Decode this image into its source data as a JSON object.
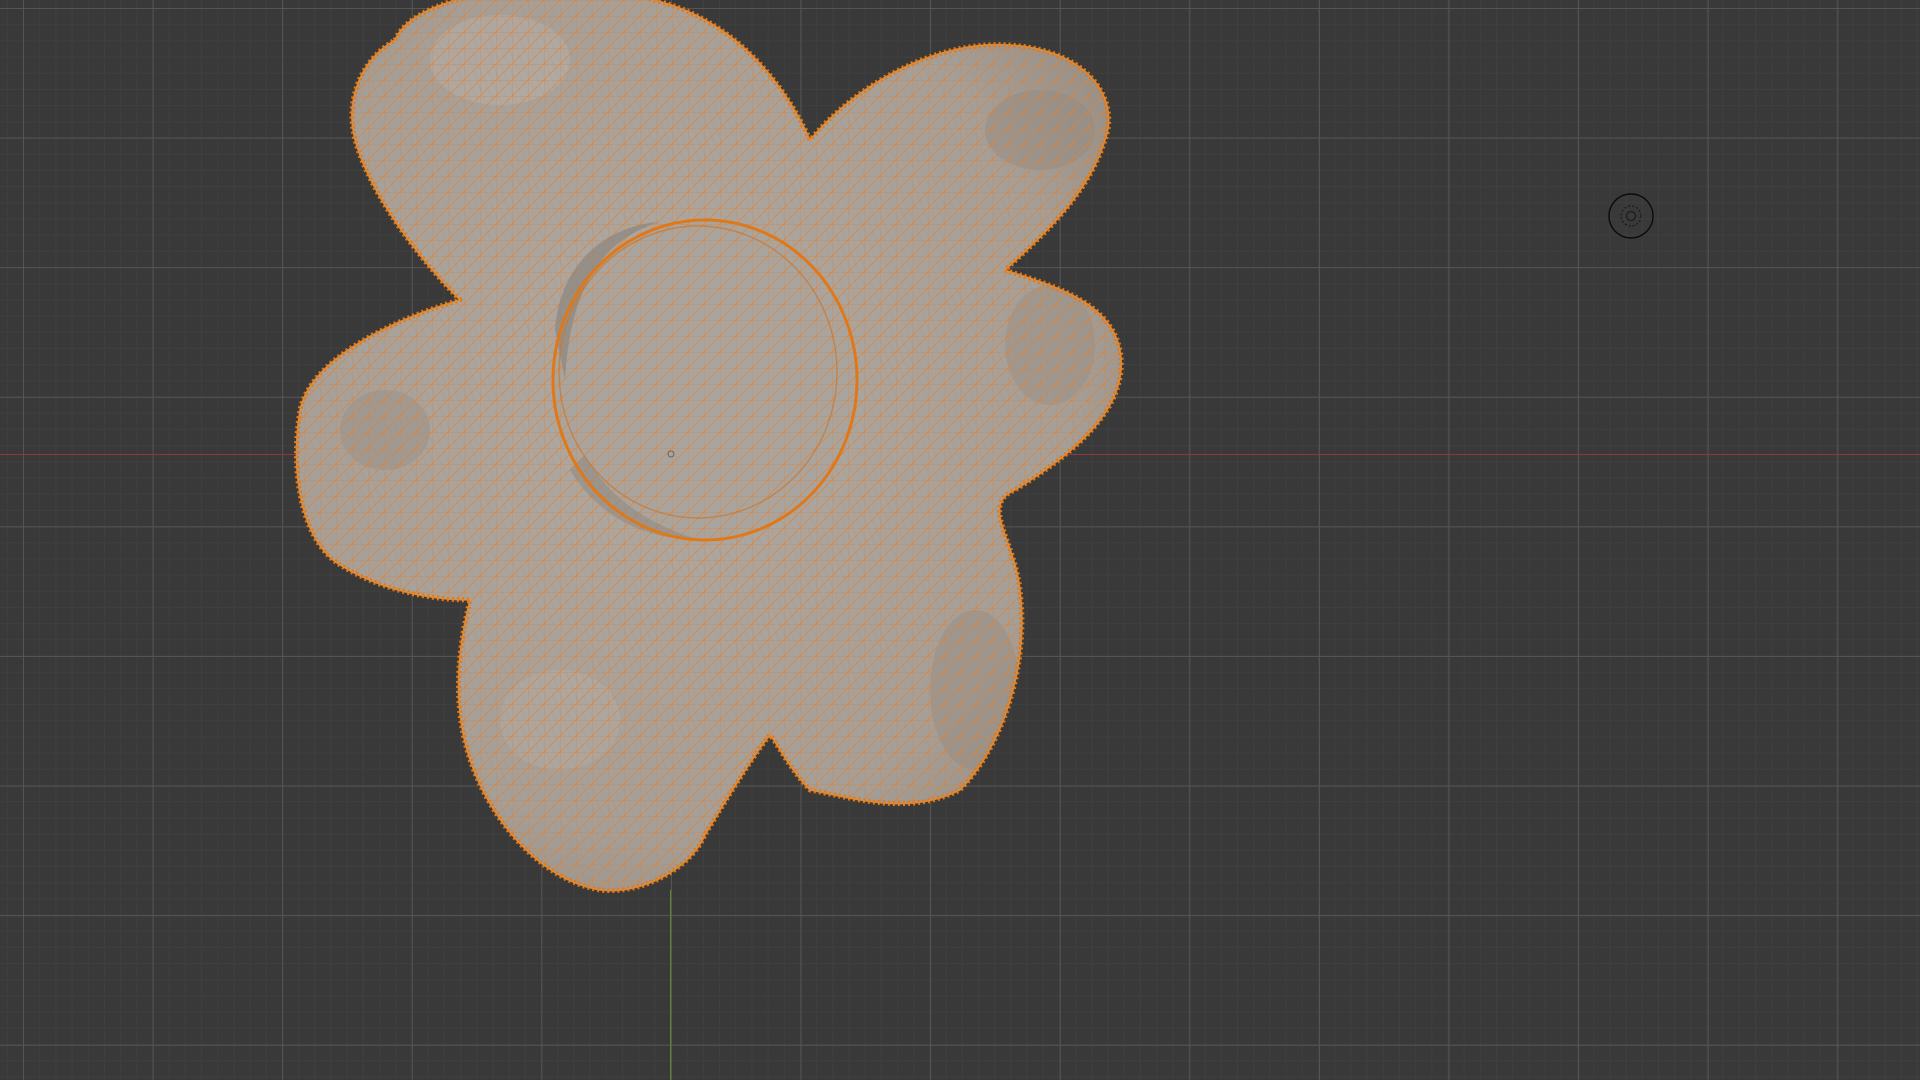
{
  "viewport": {
    "background_color": "#393939",
    "grid_major_color": "#565656",
    "grid_minor_color": "#404040",
    "axis_x_color": "#8a3a3e",
    "axis_y_color": "#5e8a2a"
  },
  "selected_object": {
    "shape": "flower",
    "mesh_fill_color": "#a9a39d",
    "wire_color": "#e98a2a",
    "outline_color": "#e07818",
    "display": "wireframe-overlay"
  },
  "icons": {
    "light_gizmo": "light-icon",
    "origin": "origin-dot-icon"
  }
}
